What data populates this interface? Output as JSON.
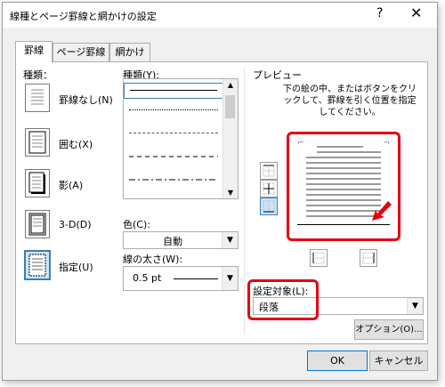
{
  "dialog": {
    "title": "線種とページ罫線と網かけの設定",
    "help": "?",
    "close": "✕"
  },
  "tabs": [
    {
      "label": "罫線",
      "active": true
    },
    {
      "label": "ページ罫線",
      "active": false
    },
    {
      "label": "網かけ",
      "active": false
    }
  ],
  "settings": {
    "heading": "種類：",
    "items": [
      {
        "label": "罫線なし(N)",
        "selected": false
      },
      {
        "label": "囲む(X)",
        "selected": false
      },
      {
        "label": "影(A)",
        "selected": false
      },
      {
        "label": "3-D(D)",
        "selected": false
      },
      {
        "label": "指定(U)",
        "selected": true
      }
    ]
  },
  "style": {
    "heading": "種類(Y):",
    "line_styles": [
      "solid",
      "dotted-fine",
      "dotted",
      "dashed",
      "dash-dot"
    ]
  },
  "color": {
    "label": "色(C):",
    "value": "自動"
  },
  "width": {
    "label": "線の太さ(W):",
    "value": "0.5 pt"
  },
  "preview": {
    "heading": "プレビュー",
    "instruction": "下の絵の中、またはボタンをクリックして、罫線を引く位置を指定してください。"
  },
  "apply_to": {
    "label": "設定対象(L):",
    "value": "段落"
  },
  "buttons": {
    "options": "オプション(O)...",
    "ok": "OK",
    "cancel": "キャンセル"
  },
  "accent": {
    "highlight_red": "#e60012",
    "selection_blue": "#3c7fb1",
    "selection_fill": "#cce4f7"
  }
}
